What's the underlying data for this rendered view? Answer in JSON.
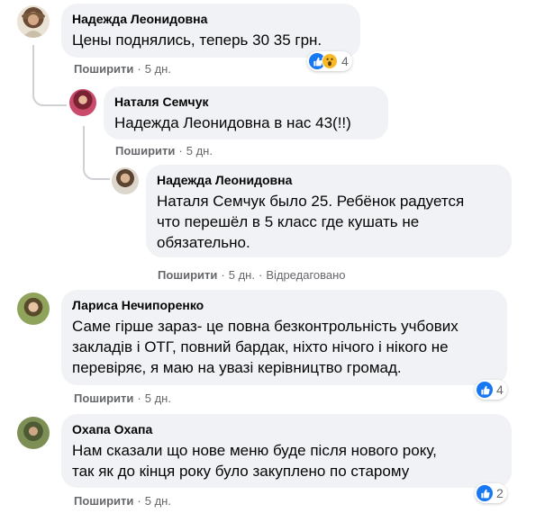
{
  "comments": [
    {
      "author": "Надежда Леонидовна",
      "text": "Цены поднялись, теперь 30 35 грн.",
      "share": "Поширити",
      "time": "5 дн.",
      "reactions": {
        "icons": [
          "like-icon",
          "wow-icon"
        ],
        "count": "4"
      }
    },
    {
      "author": "Наталя Семчук",
      "text": "Надежда Леонидовна в нас 43(!!)",
      "share": "Поширити",
      "time": "5 дн."
    },
    {
      "author": "Надежда Леонидовна",
      "text_lines": [
        "Наталя Семчук было 25. Ребёнок радуется",
        "что перешёл в 5 класс где кушать не",
        "обязательно."
      ],
      "share": "Поширити",
      "time": "5 дн.",
      "edited": "Відредаговано"
    },
    {
      "author": "Лариса Нечипоренко",
      "text_lines": [
        "Саме гірше зараз- це повна безконтрольність учбових",
        "закладів і ОТГ, повний бардак, ніхто нічого і нікого не",
        "перевіряє, я маю на увазі керівництво громад."
      ],
      "share": "Поширити",
      "time": "5 дн.",
      "reactions": {
        "icons": [
          "like-icon"
        ],
        "count": "4"
      }
    },
    {
      "author": "Охапа Охапа",
      "text_lines": [
        "Нам сказали що нове меню буде після нового року,",
        "так як до кінця року було закуплено по старому"
      ],
      "share": "Поширити",
      "time": "5 дн.",
      "reactions": {
        "icons": [
          "like-icon"
        ],
        "count": "2"
      }
    }
  ],
  "colors": {
    "bubble": "#f0f2f5",
    "meta": "#65676b",
    "like": "#1877f2",
    "wow": "#f7b928"
  }
}
